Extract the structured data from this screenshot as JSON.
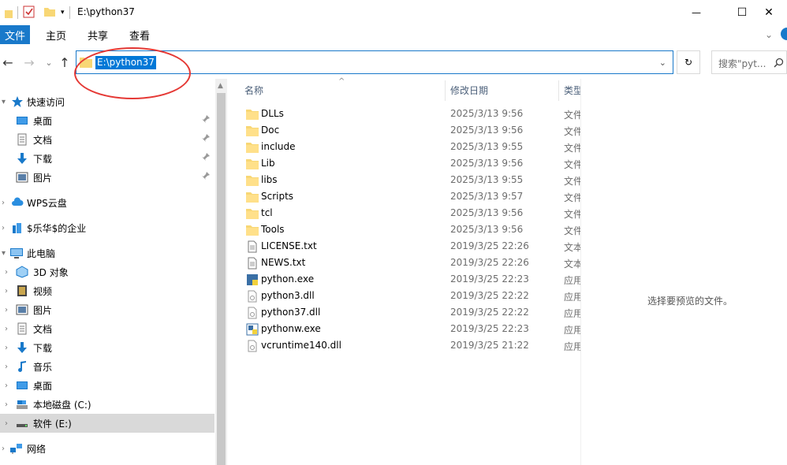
{
  "window": {
    "title": "E:\\python37",
    "minimize_glyph": "—",
    "maximize_glyph": "☐",
    "close_glyph": "✕"
  },
  "ribbon": {
    "tabs": [
      "文件",
      "主页",
      "共享",
      "查看"
    ]
  },
  "address": {
    "path": "E:\\python37",
    "back": "←",
    "forward": "→",
    "recent": "⌄",
    "up": "↑",
    "refresh": "↻"
  },
  "search": {
    "placeholder": "搜索\"pyt..."
  },
  "nav": {
    "items": [
      {
        "label": "快速访问",
        "icon": "star-icon",
        "level": 0,
        "pinned": false
      },
      {
        "label": "桌面",
        "icon": "desktop-icon",
        "level": 1,
        "pinned": true
      },
      {
        "label": "文档",
        "icon": "document-icon",
        "level": 1,
        "pinned": true
      },
      {
        "label": "下载",
        "icon": "download-icon",
        "level": 1,
        "pinned": true
      },
      {
        "label": "图片",
        "icon": "picture-icon",
        "level": 1,
        "pinned": true
      },
      {
        "label": "WPS云盘",
        "icon": "cloud-icon",
        "level": 0,
        "pinned": false
      },
      {
        "label": "$乐华$的企业",
        "icon": "enterprise-icon",
        "level": 0,
        "pinned": false
      },
      {
        "label": "此电脑",
        "icon": "computer-icon",
        "level": 0,
        "pinned": false
      },
      {
        "label": "3D 对象",
        "icon": "3d-objects-icon",
        "level": 1,
        "pinned": false
      },
      {
        "label": "视频",
        "icon": "video-icon",
        "level": 1,
        "pinned": false
      },
      {
        "label": "图片",
        "icon": "picture-icon",
        "level": 1,
        "pinned": false
      },
      {
        "label": "文档",
        "icon": "document-icon",
        "level": 1,
        "pinned": false
      },
      {
        "label": "下载",
        "icon": "download-icon",
        "level": 1,
        "pinned": false
      },
      {
        "label": "音乐",
        "icon": "music-icon",
        "level": 1,
        "pinned": false
      },
      {
        "label": "桌面",
        "icon": "desktop-icon",
        "level": 1,
        "pinned": false
      },
      {
        "label": "本地磁盘 (C:)",
        "icon": "drive-icon",
        "level": 1,
        "pinned": false
      },
      {
        "label": "软件 (E:)",
        "icon": "drive-icon",
        "level": 1,
        "pinned": false,
        "selected": true
      },
      {
        "label": "网络",
        "icon": "network-icon",
        "level": 0,
        "pinned": false
      }
    ]
  },
  "columns": {
    "name": "名称",
    "date": "修改日期",
    "type": "类型"
  },
  "files": [
    {
      "name": "DLLs",
      "date": "2025/3/13 9:56",
      "type": "文件",
      "icon": "folder-icon"
    },
    {
      "name": "Doc",
      "date": "2025/3/13 9:56",
      "type": "文件",
      "icon": "folder-icon"
    },
    {
      "name": "include",
      "date": "2025/3/13 9:55",
      "type": "文件",
      "icon": "folder-icon"
    },
    {
      "name": "Lib",
      "date": "2025/3/13 9:56",
      "type": "文件",
      "icon": "folder-icon"
    },
    {
      "name": "libs",
      "date": "2025/3/13 9:55",
      "type": "文件",
      "icon": "folder-icon"
    },
    {
      "name": "Scripts",
      "date": "2025/3/13 9:57",
      "type": "文件",
      "icon": "folder-icon"
    },
    {
      "name": "tcl",
      "date": "2025/3/13 9:56",
      "type": "文件",
      "icon": "folder-icon"
    },
    {
      "name": "Tools",
      "date": "2025/3/13 9:56",
      "type": "文件",
      "icon": "folder-icon"
    },
    {
      "name": "LICENSE.txt",
      "date": "2019/3/25 22:26",
      "type": "文本",
      "icon": "text-file-icon"
    },
    {
      "name": "NEWS.txt",
      "date": "2019/3/25 22:26",
      "type": "文本",
      "icon": "text-file-icon"
    },
    {
      "name": "python.exe",
      "date": "2019/3/25 22:23",
      "type": "应用",
      "icon": "python-exe-icon"
    },
    {
      "name": "python3.dll",
      "date": "2019/3/25 22:22",
      "type": "应用",
      "icon": "dll-file-icon"
    },
    {
      "name": "python37.dll",
      "date": "2019/3/25 22:22",
      "type": "应用",
      "icon": "dll-file-icon"
    },
    {
      "name": "pythonw.exe",
      "date": "2019/3/25 22:23",
      "type": "应用",
      "icon": "pythonw-exe-icon"
    },
    {
      "name": "vcruntime140.dll",
      "date": "2019/3/25 21:22",
      "type": "应用",
      "icon": "dll-file-icon"
    }
  ],
  "preview": {
    "message": "选择要预览的文件。"
  },
  "colors": {
    "accent": "#1979ca",
    "selection": "#0078d7",
    "annotation": "#e53935",
    "folder": "#f8d775"
  }
}
